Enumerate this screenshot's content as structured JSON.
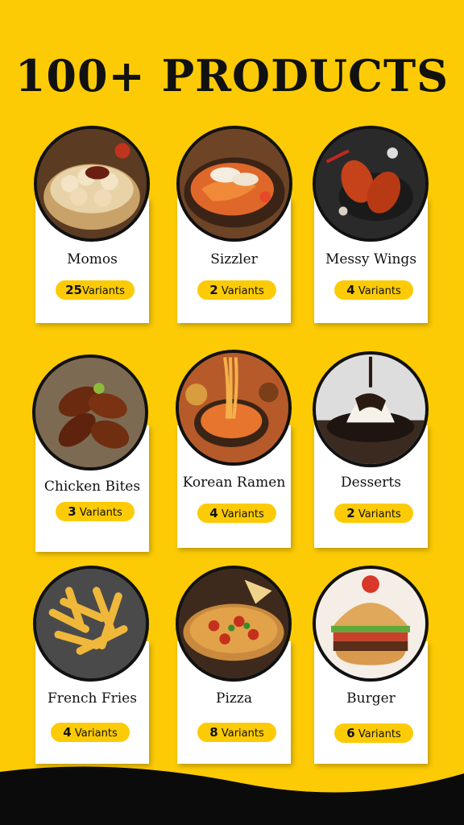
{
  "title": "100+ PRODUCTS",
  "products": [
    {
      "name": "Momos",
      "count": "25",
      "unit": "Variants",
      "icon": "momos-photo"
    },
    {
      "name": "Sizzler",
      "count": "2",
      "unit": "Variants",
      "icon": "sizzler-photo"
    },
    {
      "name": "Messy Wings",
      "count": "4",
      "unit": "Variants",
      "icon": "wings-photo"
    },
    {
      "name": "Chicken Bites",
      "count": "3",
      "unit": "Variants",
      "icon": "chicken-bites-photo"
    },
    {
      "name": "Korean Ramen",
      "count": "4",
      "unit": "Variants",
      "icon": "ramen-photo"
    },
    {
      "name": "Desserts",
      "count": "2",
      "unit": "Variants",
      "icon": "dessert-photo"
    },
    {
      "name": "French Fries",
      "count": "4",
      "unit": "Variants",
      "icon": "fries-photo"
    },
    {
      "name": "Pizza",
      "count": "8",
      "unit": "Variants",
      "icon": "pizza-photo"
    },
    {
      "name": "Burger",
      "count": "6",
      "unit": "Variants",
      "icon": "burger-photo"
    }
  ],
  "colors": {
    "background": "#fccb05",
    "text": "#111111",
    "card": "#ffffff"
  }
}
